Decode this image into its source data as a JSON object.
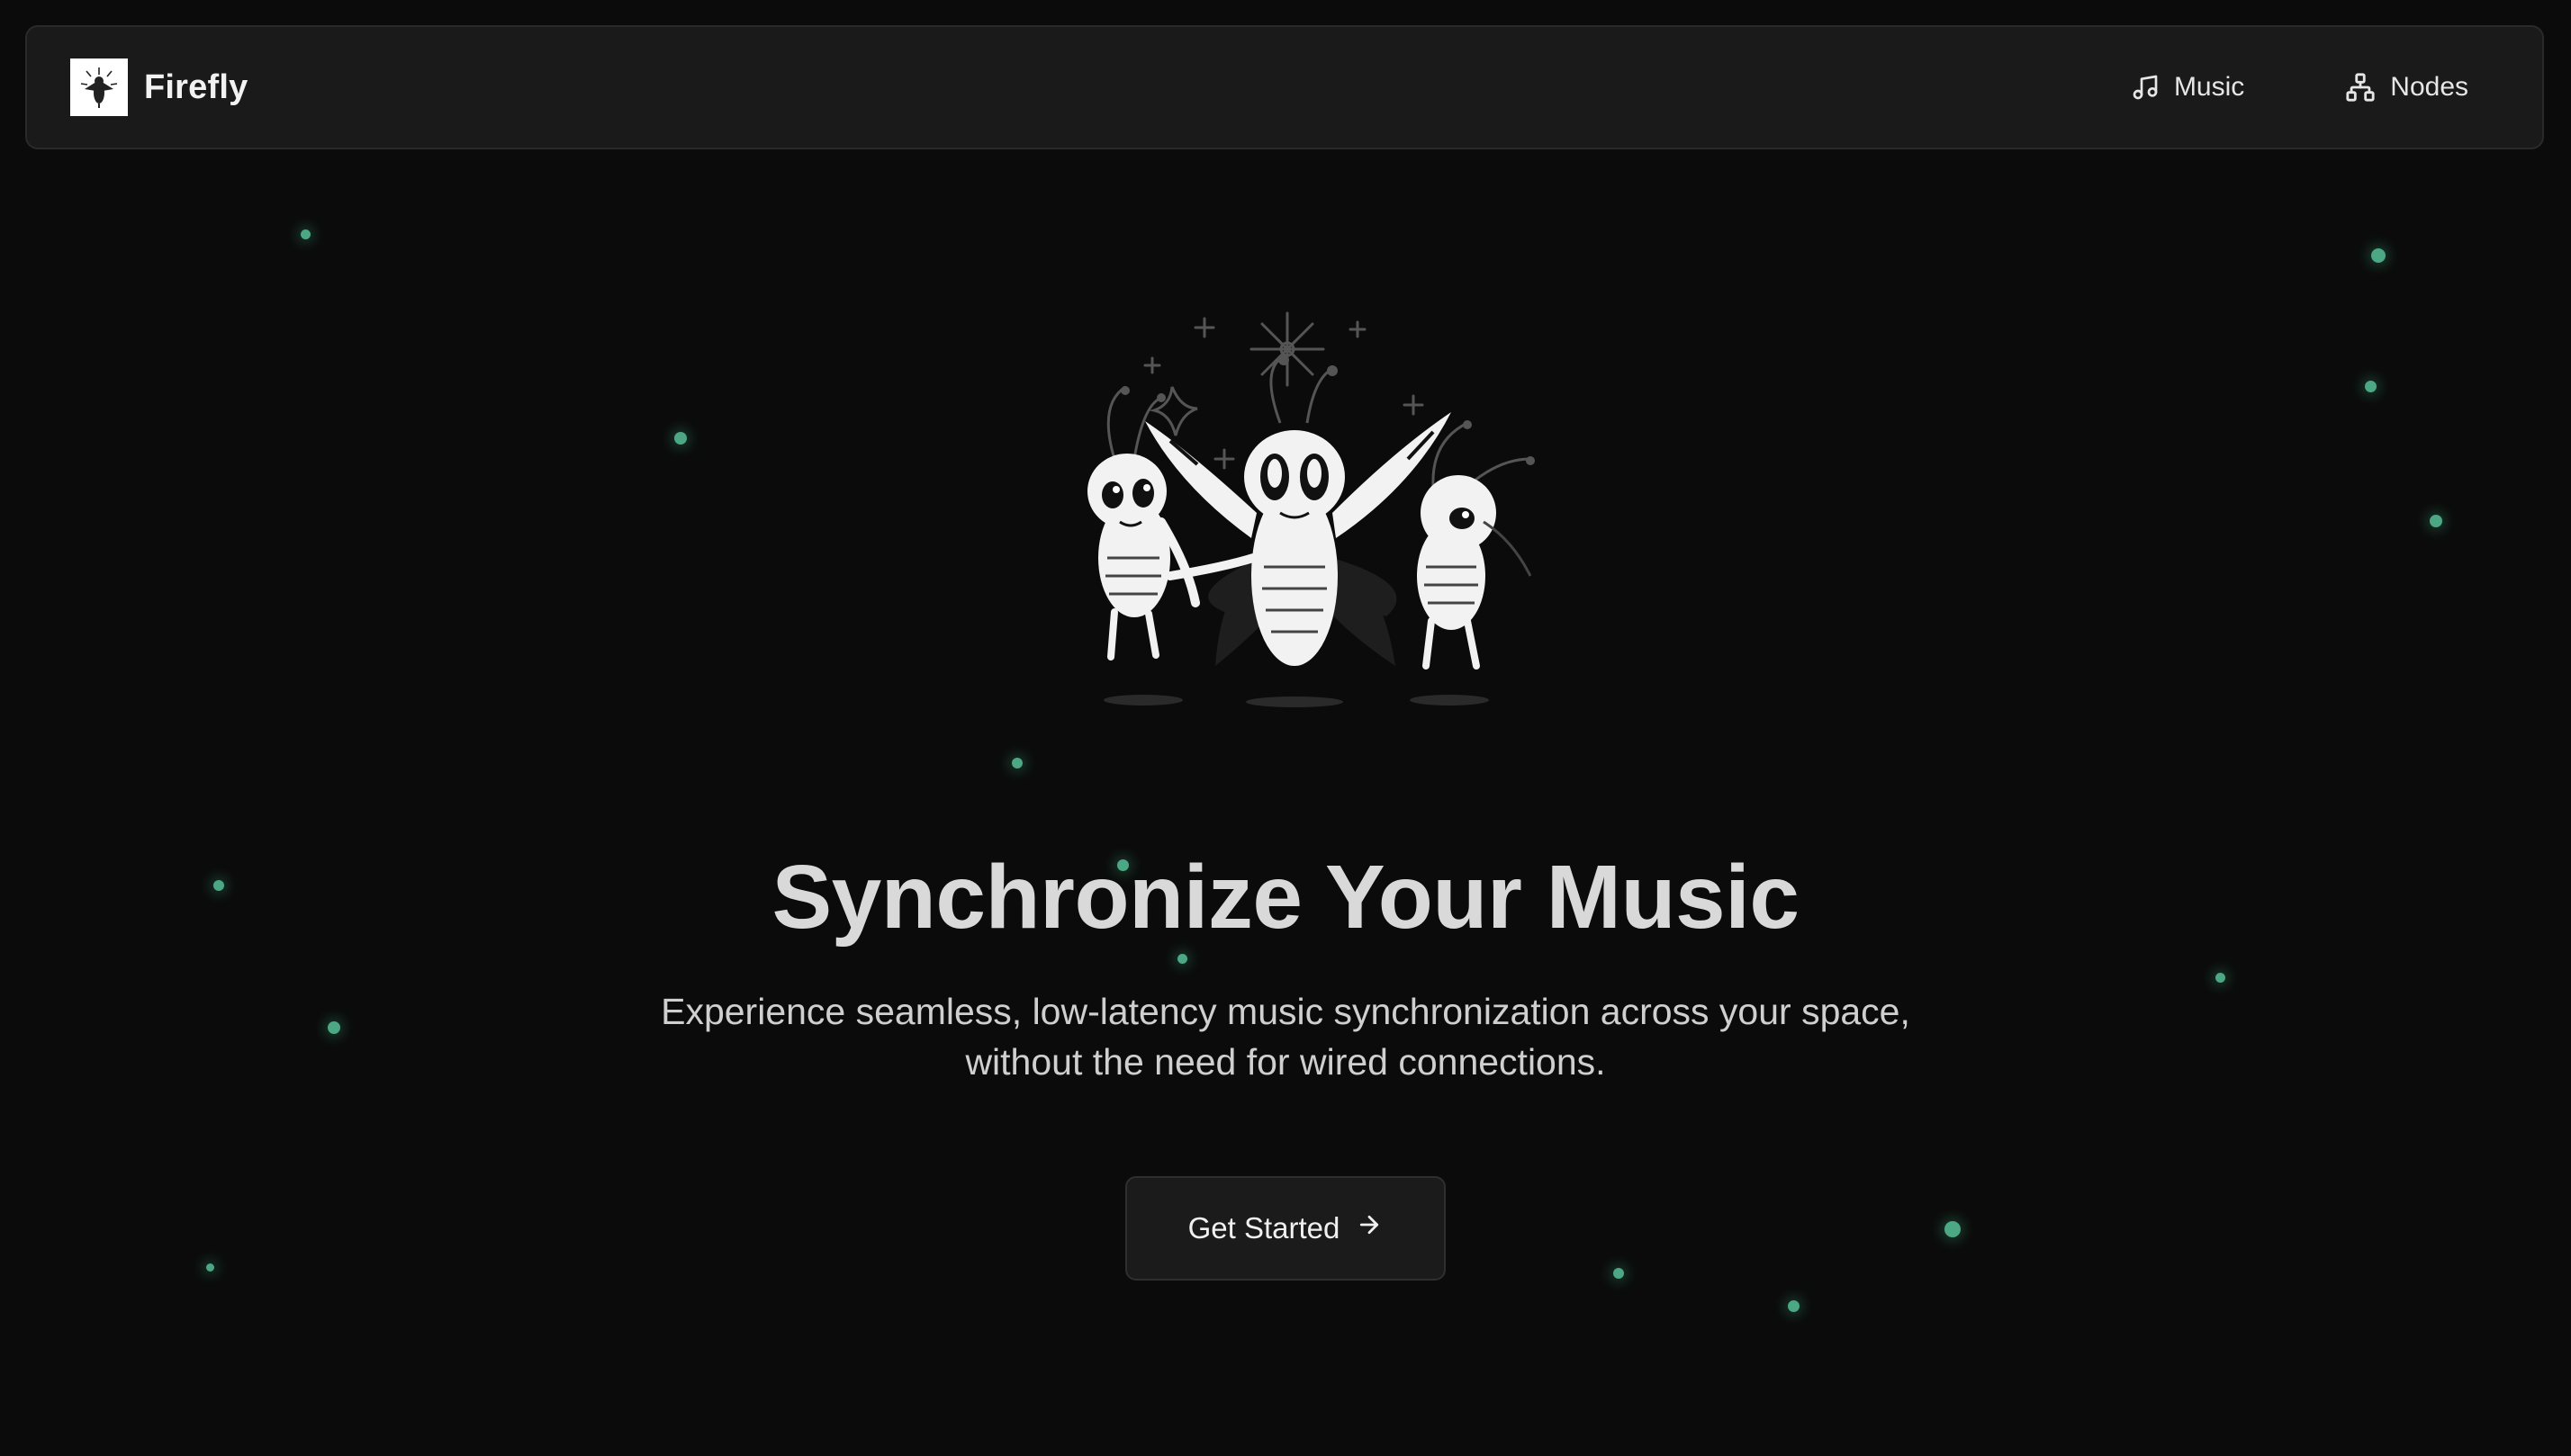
{
  "navbar": {
    "brand": {
      "name": "Firefly",
      "logo_icon": "firefly-logo-icon"
    },
    "links": [
      {
        "label": "Music",
        "icon": "music-note-icon"
      },
      {
        "label": "Nodes",
        "icon": "network-nodes-icon"
      }
    ]
  },
  "hero": {
    "illustration": "dancing-fireflies-illustration",
    "title": "Synchronize Your Music",
    "subtitle": "Experience seamless, low-latency music synchronization across your space, without the need for wired connections.",
    "cta": {
      "label": "Get Started",
      "icon": "arrow-right-icon"
    }
  },
  "colors": {
    "background": "#0b0b0b",
    "navbar_bg": "#1a1a1a",
    "firefly_glow": "#5fd3a8",
    "title_text": "#d9d9d9"
  }
}
